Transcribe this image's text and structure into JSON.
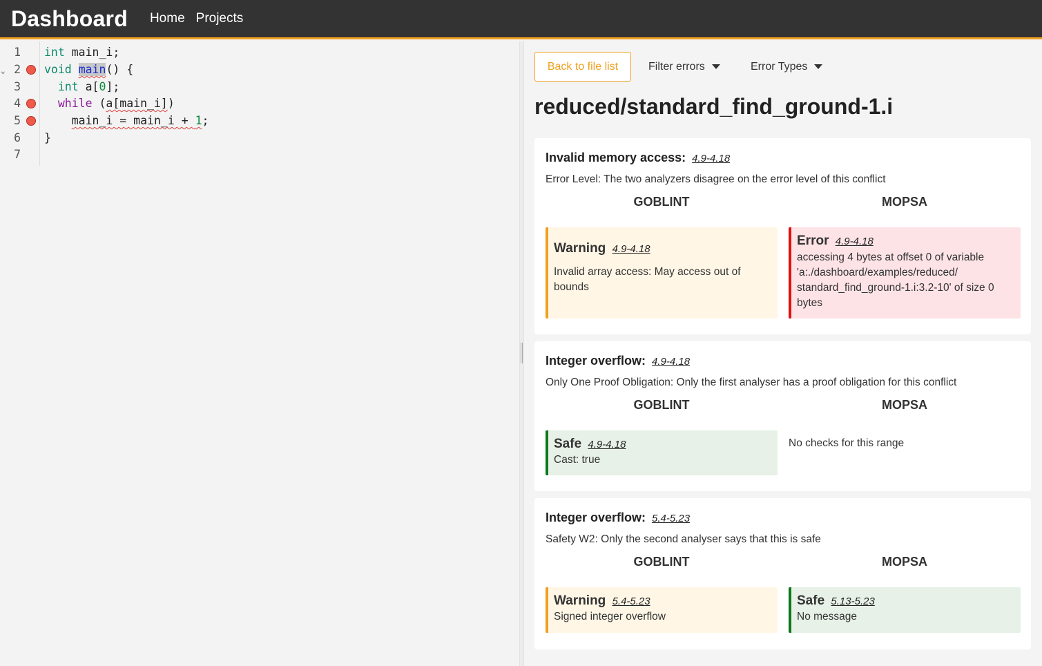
{
  "navbar": {
    "brand": "Dashboard",
    "links": [
      "Home",
      "Projects"
    ]
  },
  "editor": {
    "line_numbers": [
      "1",
      "2",
      "3",
      "4",
      "5",
      "6",
      "7"
    ],
    "breakpoint_lines": [
      2,
      4,
      5
    ],
    "fold_line": 2
  },
  "toolbar": {
    "back_label": "Back to file list",
    "filter_label": "Filter errors",
    "types_label": "Error Types"
  },
  "file_title": "reduced/standard_find_ground-1.i",
  "col_left": "GOBLINT",
  "col_right": "MOPSA",
  "conflicts": [
    {
      "title": "Invalid memory access:",
      "range": "4.9-4.18",
      "desc": "Error Level: The two analyzers disagree on the error level of this conflict",
      "left": {
        "kind": "Warning",
        "range": "4.9-4.18",
        "message": "Invalid array access: May access out of bounds"
      },
      "right": {
        "kind": "Error",
        "range": "4.9-4.18",
        "message": "accessing 4 bytes at offset 0 of variable 'a:./dashboard/examples/reduced/ standard_find_ground-1.i:3.2-10' of size 0 bytes"
      }
    },
    {
      "title": "Integer overflow:",
      "range": "4.9-4.18",
      "desc": "Only One Proof Obligation: Only the first analyser has a proof obligation for this conflict",
      "left": {
        "kind": "Safe",
        "range": "4.9-4.18",
        "message": "Cast: true"
      },
      "right_none": "No checks for this range"
    },
    {
      "title": "Integer overflow:",
      "range": "5.4-5.23",
      "desc": "Safety W2: Only the second analyser says that this is safe",
      "left": {
        "kind": "Warning",
        "range": "5.4-5.23",
        "message": "Signed integer overflow"
      },
      "right": {
        "kind": "Safe",
        "range": "5.13-5.23",
        "message": "No message"
      }
    }
  ]
}
